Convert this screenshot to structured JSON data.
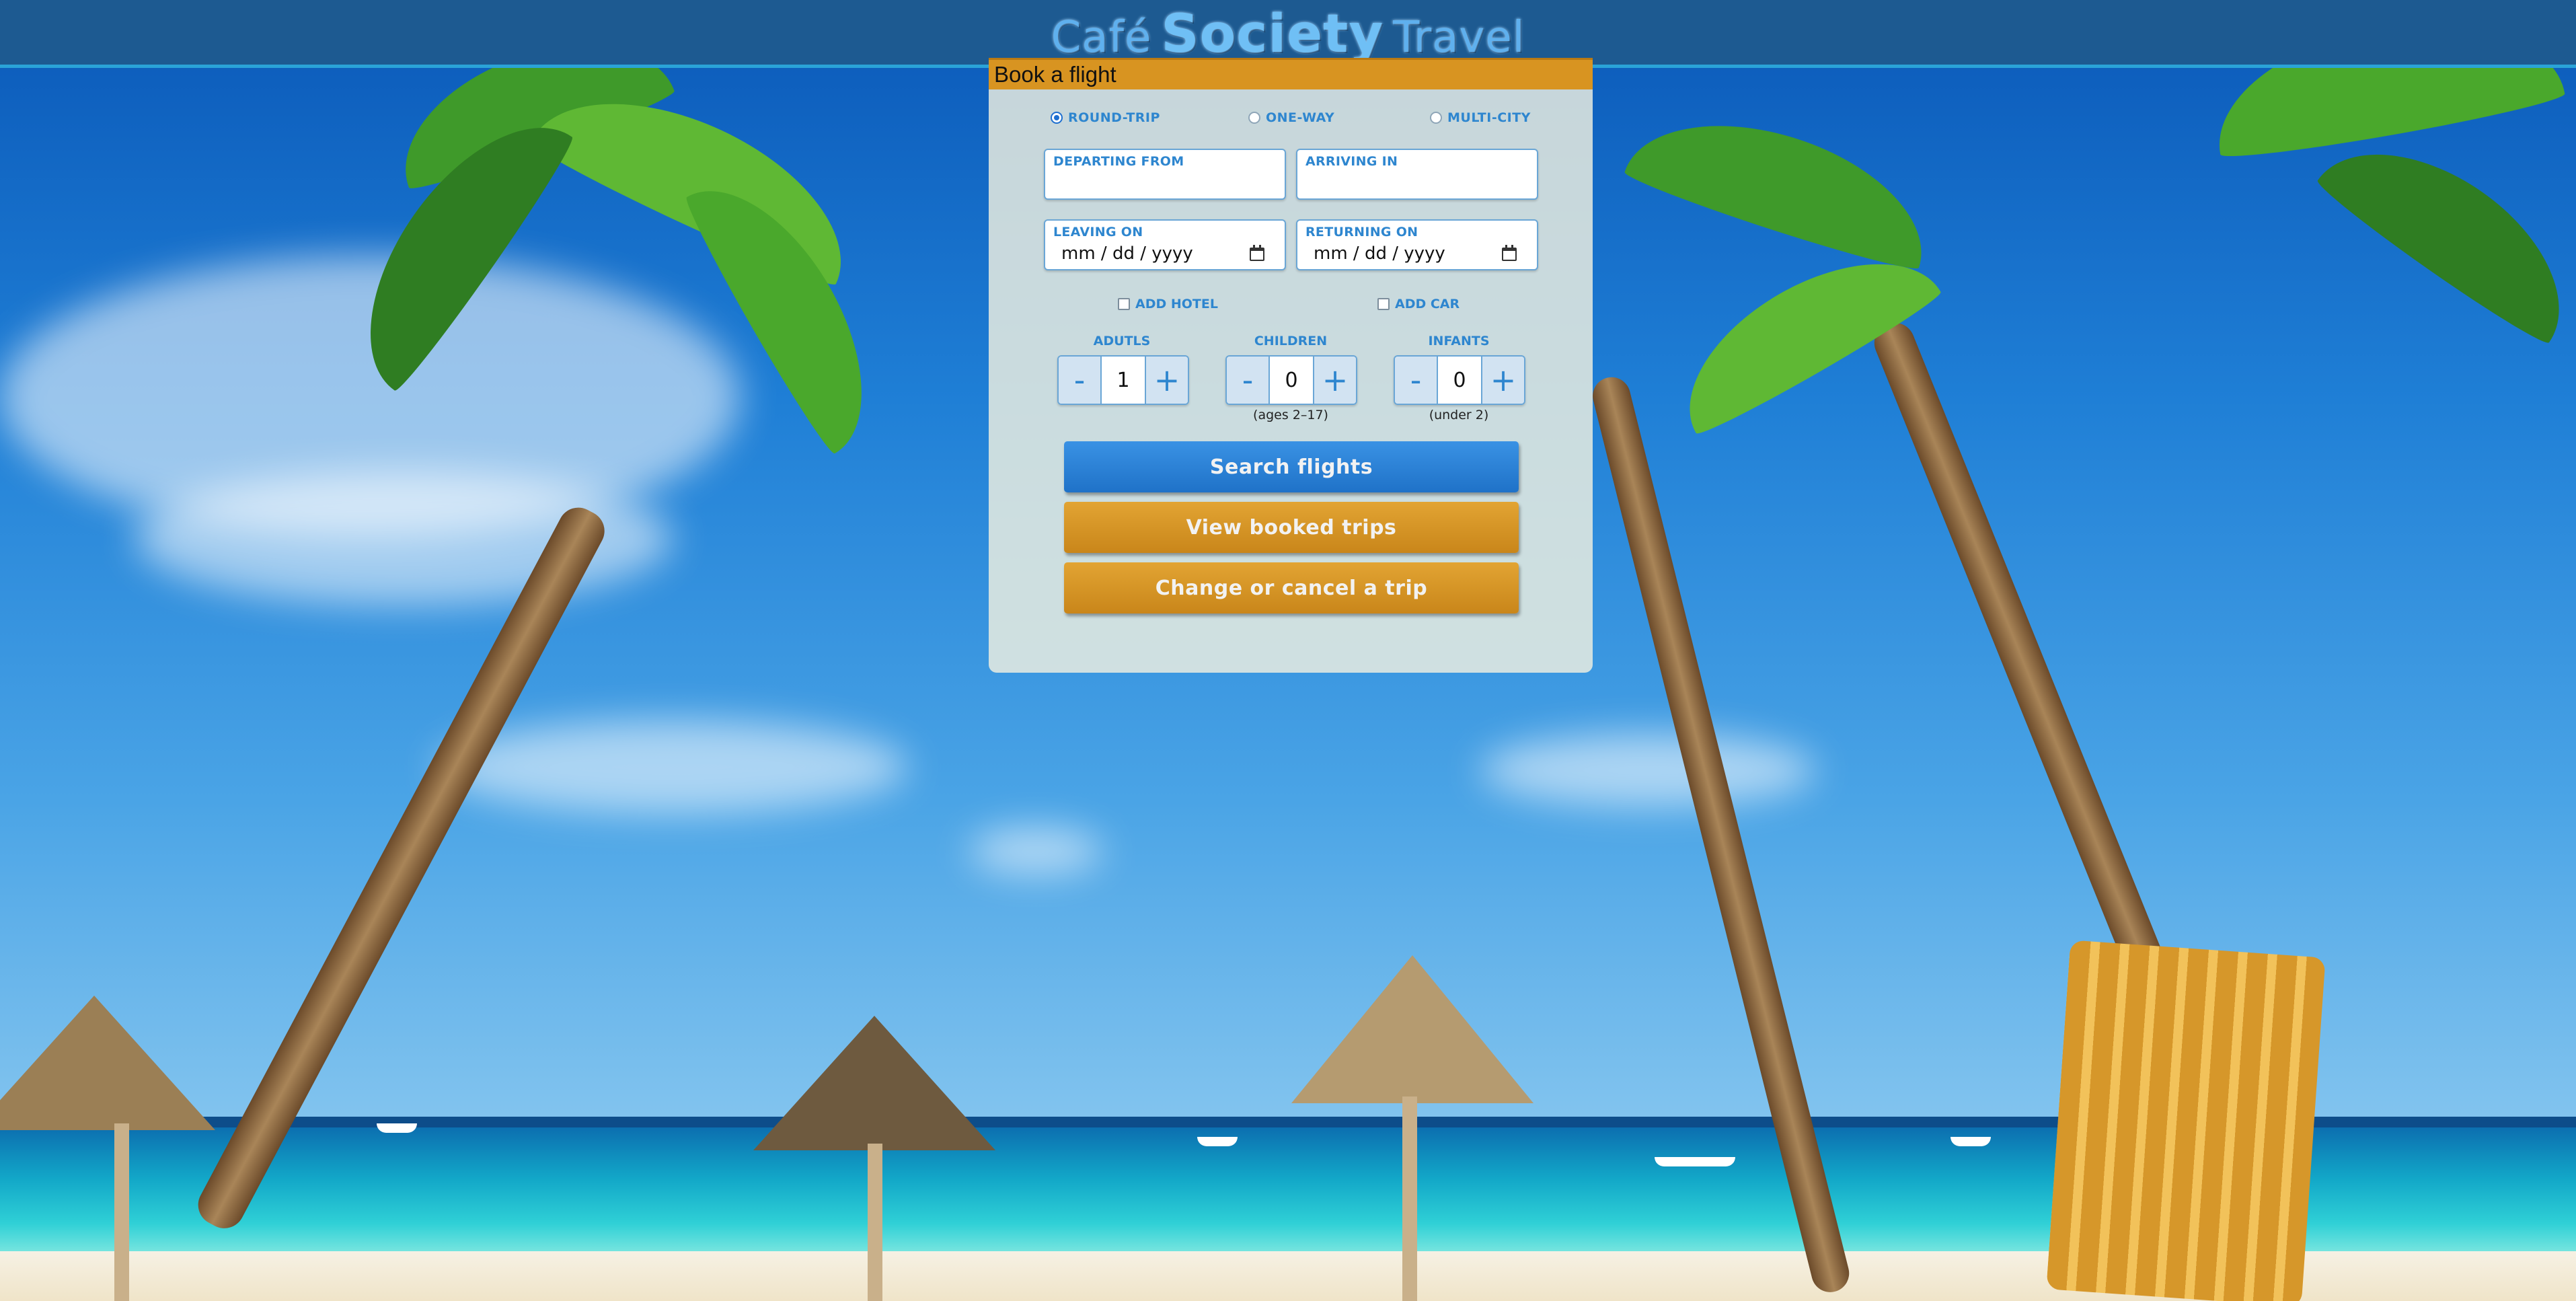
{
  "header": {
    "logo_word1": "Café",
    "logo_word2": "Society",
    "logo_word3": "Travel"
  },
  "panel": {
    "title": "Book a flight",
    "trip_types": [
      {
        "label": "ROUND-TRIP",
        "selected": true
      },
      {
        "label": "ONE-WAY",
        "selected": false
      },
      {
        "label": "MULTI-CITY",
        "selected": false
      }
    ],
    "departing_label": "DEPARTING FROM",
    "departing_value": "",
    "arriving_label": "ARRIVING IN",
    "arriving_value": "",
    "leaving_label": "LEAVING ON",
    "leaving_placeholder": "mm / dd / yyyy",
    "returning_label": "RETURNING ON",
    "returning_placeholder": "mm / dd / yyyy",
    "add_hotel_label": "ADD HOTEL",
    "add_car_label": "ADD CAR",
    "adults": {
      "label": "ADUTLS",
      "minus": "-",
      "value": "1",
      "plus": "+"
    },
    "children": {
      "label": "CHILDREN",
      "minus": "-",
      "value": "0",
      "plus": "+",
      "note": "(ages 2–17)"
    },
    "infants": {
      "label": "INFANTS",
      "minus": "-",
      "value": "0",
      "plus": "+",
      "note": "(under 2)"
    },
    "search_button": "Search flights",
    "view_button": "View booked trips",
    "change_button": "Change or cancel a trip"
  },
  "colors": {
    "header_bg": "#1d5a91",
    "title_bar": "#d89421",
    "accent_blue": "#2e86cf",
    "search_button": "#2a82d8",
    "gold_button": "#d6951f"
  }
}
